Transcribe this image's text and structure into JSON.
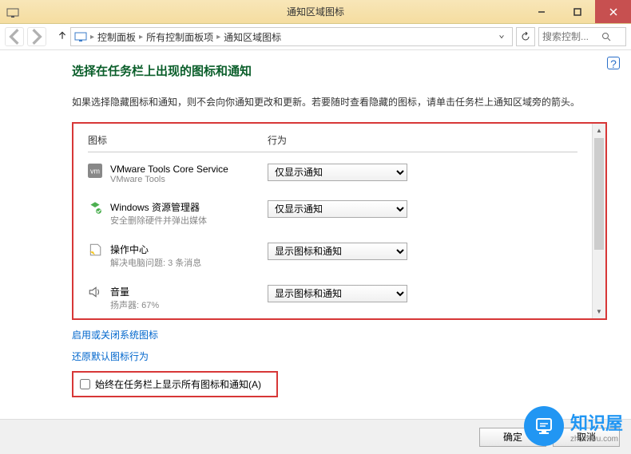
{
  "titlebar": {
    "title": "通知区域图标"
  },
  "breadcrumb": {
    "items": [
      "控制面板",
      "所有控制面板项",
      "通知区域图标"
    ]
  },
  "search": {
    "placeholder": "搜索控制..."
  },
  "page": {
    "title": "选择在任务栏上出现的图标和通知",
    "description": "如果选择隐藏图标和通知，则不会向你通知更改和更新。若要随时查看隐藏的图标，请单击任务栏上通知区域旁的箭头。"
  },
  "headers": {
    "icon": "图标",
    "action": "行为"
  },
  "items": [
    {
      "name": "VMware Tools Core Service",
      "desc": "VMware Tools",
      "action": "仅显示通知"
    },
    {
      "name": "Windows 资源管理器",
      "desc": "安全删除硬件并弹出媒体",
      "action": "仅显示通知"
    },
    {
      "name": "操作中心",
      "desc": "解决电脑问题: 3 条消息",
      "action": "显示图标和通知"
    },
    {
      "name": "音量",
      "desc": "扬声器: 67%",
      "action": "显示图标和通知"
    }
  ],
  "links": {
    "system_icons": "启用或关闭系统图标",
    "restore_defaults": "还原默认图标行为"
  },
  "checkbox": {
    "label": "始终在任务栏上显示所有图标和通知(A)"
  },
  "footer": {
    "ok": "确定",
    "cancel": "取消"
  },
  "watermark": {
    "title": "知识屋",
    "url": "zhishiwu.com"
  }
}
